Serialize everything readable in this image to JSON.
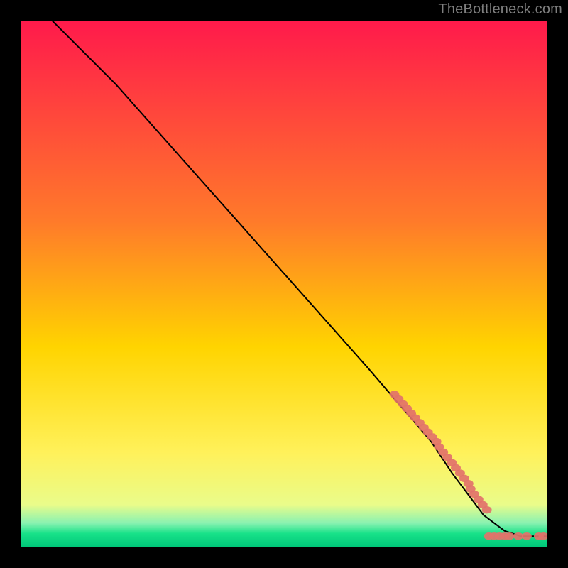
{
  "attribution": "TheBottleneck.com",
  "chart_data": {
    "type": "line",
    "title": "",
    "xlabel": "",
    "ylabel": "",
    "xlim": [
      0,
      100
    ],
    "ylim": [
      0,
      100
    ],
    "grid": false,
    "legend": "none",
    "gradient_stops": [
      {
        "offset": 0.0,
        "color": "#ff1a4b"
      },
      {
        "offset": 0.38,
        "color": "#ff7a2a"
      },
      {
        "offset": 0.62,
        "color": "#ffd400"
      },
      {
        "offset": 0.82,
        "color": "#fff15a"
      },
      {
        "offset": 0.92,
        "color": "#eafc8a"
      },
      {
        "offset": 0.955,
        "color": "#89f2b1"
      },
      {
        "offset": 0.975,
        "color": "#18e289"
      },
      {
        "offset": 1.0,
        "color": "#00c779"
      }
    ],
    "series": [
      {
        "name": "curve",
        "kind": "line",
        "color": "#000000",
        "x": [
          6,
          8,
          12,
          18,
          26,
          34,
          42,
          50,
          58,
          66,
          72,
          78,
          82,
          85,
          88,
          92,
          95,
          100
        ],
        "y": [
          100,
          98,
          94,
          88,
          79,
          70,
          61,
          52,
          43,
          34,
          27,
          20,
          14,
          10,
          6,
          3,
          2,
          2
        ]
      },
      {
        "name": "diagonal-markers",
        "kind": "scatter",
        "color": "#e2726a",
        "x": [
          71.0,
          71.8,
          72.6,
          73.4,
          74.2,
          75.0,
          75.8,
          76.6,
          77.4,
          78.2,
          79.0,
          79.5,
          80.3,
          81.1,
          81.9,
          82.7,
          83.5,
          84.3,
          85.1,
          85.5,
          86.2,
          87.0,
          87.8,
          88.6
        ],
        "y": [
          29.0,
          28.1,
          27.2,
          26.3,
          25.4,
          24.5,
          23.6,
          22.7,
          21.8,
          20.9,
          20.0,
          19.0,
          18.0,
          17.0,
          16.0,
          15.0,
          14.0,
          13.0,
          12.0,
          11.0,
          10.0,
          9.0,
          8.0,
          7.0
        ]
      },
      {
        "name": "bottom-markers",
        "kind": "scatter",
        "color": "#e2726a",
        "x": [
          89.0,
          90.0,
          91.0,
          92.0,
          92.9,
          94.6,
          96.2,
          98.5,
          99.4
        ],
        "y": [
          2.0,
          2.0,
          2.0,
          2.0,
          2.0,
          2.0,
          2.0,
          2.0,
          2.0
        ]
      }
    ]
  }
}
